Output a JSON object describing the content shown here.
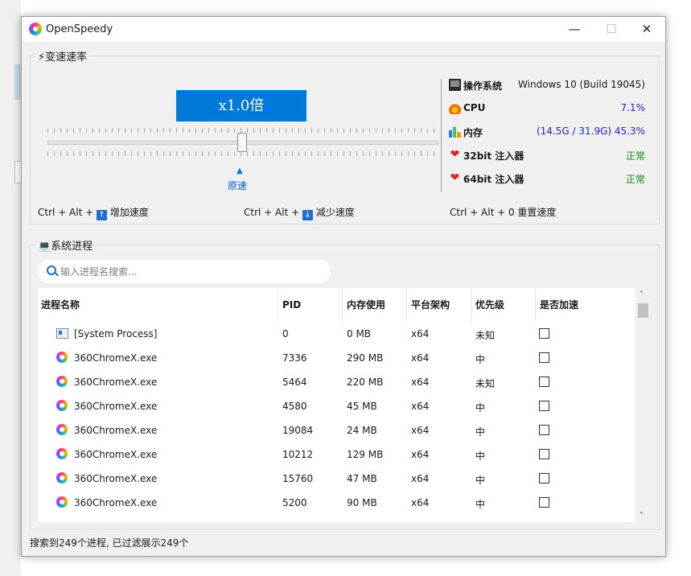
{
  "window": {
    "title": "OpenSpeedy",
    "min_label": "—",
    "max_label": "☐",
    "close_label": "✕"
  },
  "speed_group": {
    "label": "⚡变速速率",
    "display": "x1.0倍",
    "marker_arrow": "▲",
    "marker_label": "原速",
    "slider_value_fraction": 0.5
  },
  "system_info": {
    "os": {
      "label": "操作系统",
      "value": "Windows 10 (Build 19045)"
    },
    "cpu": {
      "label": "CPU",
      "value": "7.1%"
    },
    "mem": {
      "label": "内存",
      "value": "(14.5G / 31.9G) 45.3%"
    },
    "inj32": {
      "label": "32bit 注入器",
      "value": "正常"
    },
    "inj64": {
      "label": "64bit 注入器",
      "value": "正常"
    }
  },
  "hotkeys": {
    "increase": {
      "prefix": "Ctrl + Alt + ",
      "key": "↑",
      "label": "增加速度"
    },
    "decrease": {
      "prefix": "Ctrl + Alt + ",
      "key": "↓",
      "label": "减少速度"
    },
    "reset": {
      "text": "Ctrl + Alt + 0 重置速度"
    }
  },
  "process_group": {
    "label": "💻系统进程",
    "search_placeholder": "输入进程名搜索...",
    "columns": [
      "进程名称",
      "PID",
      "内存使用",
      "平台架构",
      "优先级",
      "是否加速"
    ],
    "sort_indicator": "^",
    "rows": [
      {
        "icon": "system-process-icon",
        "name": "[System Process]",
        "pid": "0",
        "mem": "0 MB",
        "arch": "x64",
        "priority": "未知",
        "accelerated": false
      },
      {
        "icon": "chrome-icon",
        "name": "360ChromeX.exe",
        "pid": "7336",
        "mem": "290 MB",
        "arch": "x64",
        "priority": "中",
        "accelerated": false
      },
      {
        "icon": "chrome-icon",
        "name": "360ChromeX.exe",
        "pid": "5464",
        "mem": "220 MB",
        "arch": "x64",
        "priority": "未知",
        "accelerated": false
      },
      {
        "icon": "chrome-icon",
        "name": "360ChromeX.exe",
        "pid": "4580",
        "mem": "45 MB",
        "arch": "x64",
        "priority": "中",
        "accelerated": false
      },
      {
        "icon": "chrome-icon",
        "name": "360ChromeX.exe",
        "pid": "19084",
        "mem": "24 MB",
        "arch": "x64",
        "priority": "中",
        "accelerated": false
      },
      {
        "icon": "chrome-icon",
        "name": "360ChromeX.exe",
        "pid": "10212",
        "mem": "129 MB",
        "arch": "x64",
        "priority": "中",
        "accelerated": false
      },
      {
        "icon": "chrome-icon",
        "name": "360ChromeX.exe",
        "pid": "15760",
        "mem": "47 MB",
        "arch": "x64",
        "priority": "中",
        "accelerated": false
      },
      {
        "icon": "chrome-icon",
        "name": "360ChromeX.exe",
        "pid": "5200",
        "mem": "90 MB",
        "arch": "x64",
        "priority": "中",
        "accelerated": false
      }
    ],
    "scroll_up": "˄",
    "scroll_down": "˅"
  },
  "status": {
    "text": "搜索到249个进程, 已过滤展示249个"
  },
  "colors": {
    "accent": "#0078d7",
    "ok": "#138a13",
    "value_blue": "#2222cc",
    "window_bg": "#f0f0f0"
  }
}
